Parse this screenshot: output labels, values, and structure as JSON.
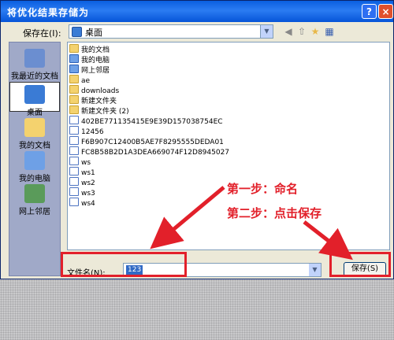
{
  "dialog": {
    "title": "将优化结果存储为",
    "help_label": "?",
    "close_label": "×",
    "save_in_label": "保存在(I):",
    "save_in_value": "桌面"
  },
  "places": [
    {
      "label": "我最近的文档"
    },
    {
      "label": "桌面"
    },
    {
      "label": "我的文档"
    },
    {
      "label": "我的电脑"
    },
    {
      "label": "网上邻居"
    }
  ],
  "files": [
    {
      "name": "我的文档",
      "kind": "folder"
    },
    {
      "name": "我的电脑",
      "kind": "sys"
    },
    {
      "name": "网上邻居",
      "kind": "sys"
    },
    {
      "name": "ae",
      "kind": "folder"
    },
    {
      "name": "downloads",
      "kind": "folder"
    },
    {
      "name": "新建文件夹",
      "kind": "folder"
    },
    {
      "name": "新建文件夹 (2)",
      "kind": "folder"
    },
    {
      "name": "402BE771135415E9E39D157038754EC",
      "kind": "doc"
    },
    {
      "name": "12456",
      "kind": "doc"
    },
    {
      "name": "F6B907C12400B5AE7F8295555DEDA01",
      "kind": "doc"
    },
    {
      "name": "FC8B58B2D1A3DEA669074F12D8945027",
      "kind": "doc"
    },
    {
      "name": "ws",
      "kind": "doc"
    },
    {
      "name": "ws1",
      "kind": "doc"
    },
    {
      "name": "ws2",
      "kind": "doc"
    },
    {
      "name": "ws3",
      "kind": "doc"
    },
    {
      "name": "ws4",
      "kind": "doc"
    }
  ],
  "filename": {
    "label": "文件名(N):",
    "value": "123"
  },
  "save_button": "保存(S)",
  "annotations": {
    "step1": "第一步：命名",
    "step2": "第二步：点击保存"
  },
  "colors": {
    "accent": "#e2202a",
    "titlebar": "#0a5fe0"
  }
}
